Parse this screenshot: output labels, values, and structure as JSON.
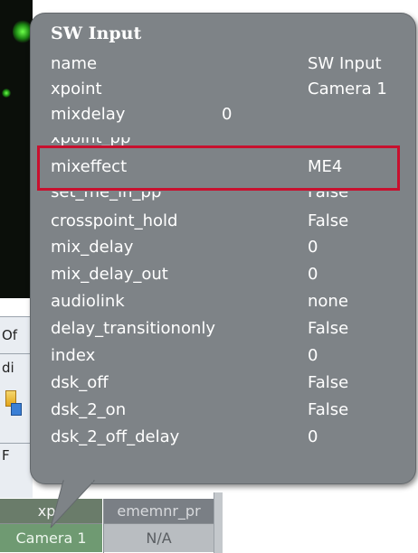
{
  "background": {
    "strip_labels": [
      "Of",
      "di",
      "F"
    ],
    "grid": {
      "columns": [
        {
          "header": "xpo",
          "value": "Camera 1"
        },
        {
          "header": "ememnr_pr",
          "value": "N/A"
        }
      ]
    }
  },
  "tooltip": {
    "title": "SW Input",
    "properties": [
      {
        "key": "name",
        "value": "SW Input"
      },
      {
        "key": "xpoint",
        "value": "Camera 1"
      },
      {
        "key": "mixdelay",
        "value": "0"
      },
      {
        "key": "xpoint_pp",
        "value": ""
      },
      {
        "key": "mixeffect",
        "value": "ME4"
      },
      {
        "key": "set_me_in_pp",
        "value": "False"
      },
      {
        "key": "crosspoint_hold",
        "value": "False"
      },
      {
        "key": "mix_delay",
        "value": "0"
      },
      {
        "key": "mix_delay_out",
        "value": "0"
      },
      {
        "key": "audiolink",
        "value": "none"
      },
      {
        "key": "delay_transitiononly",
        "value": "False"
      },
      {
        "key": "index",
        "value": "0"
      },
      {
        "key": "dsk_off",
        "value": "False"
      },
      {
        "key": "dsk_2_on",
        "value": "False"
      },
      {
        "key": "dsk_2_off_delay",
        "value": "0"
      }
    ],
    "highlighted_property": "mixeffect"
  },
  "colors": {
    "tooltip_bg": "#7e8387",
    "highlight_border": "#c8102e",
    "grid_selected": "#6f9a72"
  }
}
